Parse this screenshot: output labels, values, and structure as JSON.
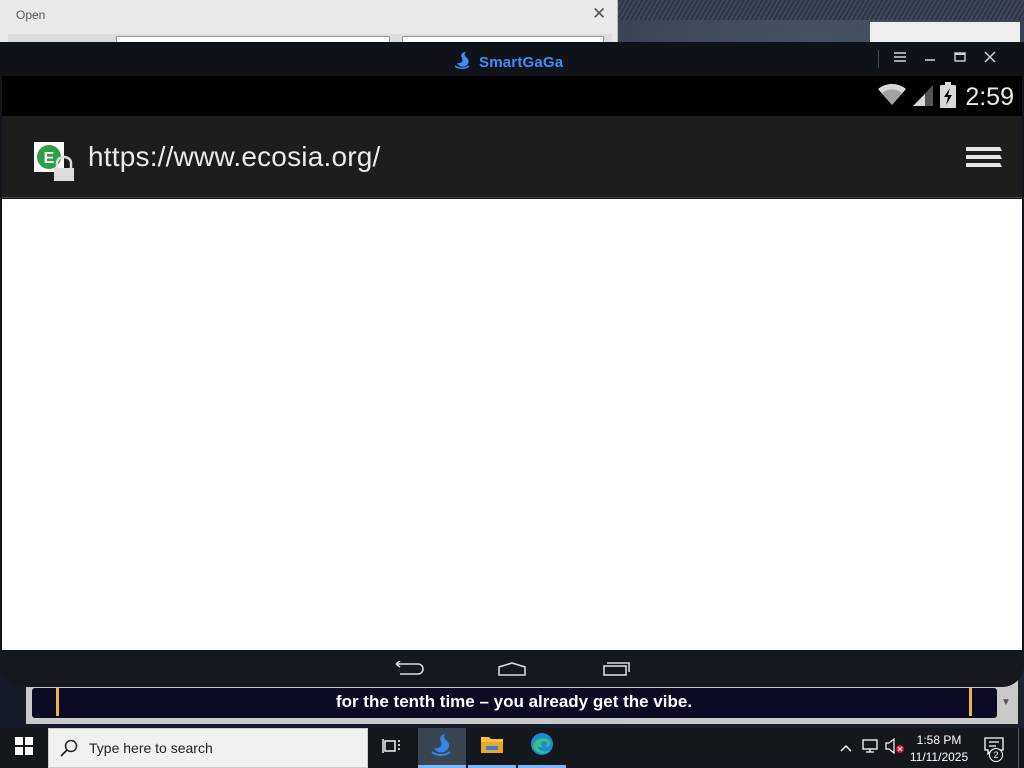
{
  "background": {
    "dialog_title": "Open",
    "dialog_close_glyph": "✕"
  },
  "emulator": {
    "brand": "SmartGaGa",
    "brand_color": "#3f8ef5",
    "controls": [
      "menu-icon",
      "minimize-icon",
      "maximize-icon",
      "close-icon"
    ]
  },
  "android": {
    "status": {
      "time": "2:59",
      "icons": [
        "wifi-icon",
        "signal-icon",
        "battery-charging-icon"
      ]
    },
    "browser": {
      "url": "https://www.ecosia.org/",
      "site_icon": "ecosia-secure-icon",
      "menu_icon": "browser-menu-icon"
    },
    "nav": [
      "back-icon",
      "home-icon",
      "recents-icon"
    ]
  },
  "subtitle": {
    "text": "for the tenth time – you already get the vibe.",
    "marker_color": "#e8b63a"
  },
  "taskbar": {
    "search_placeholder": "Type here to search",
    "pinned": [
      "task-view-icon",
      "smartgaga-icon",
      "file-explorer-icon",
      "edge-icon"
    ],
    "clock_time": "1:58 PM",
    "clock_date": "11/11/2025",
    "notification_count": "2",
    "accent": "#79b8ff"
  }
}
